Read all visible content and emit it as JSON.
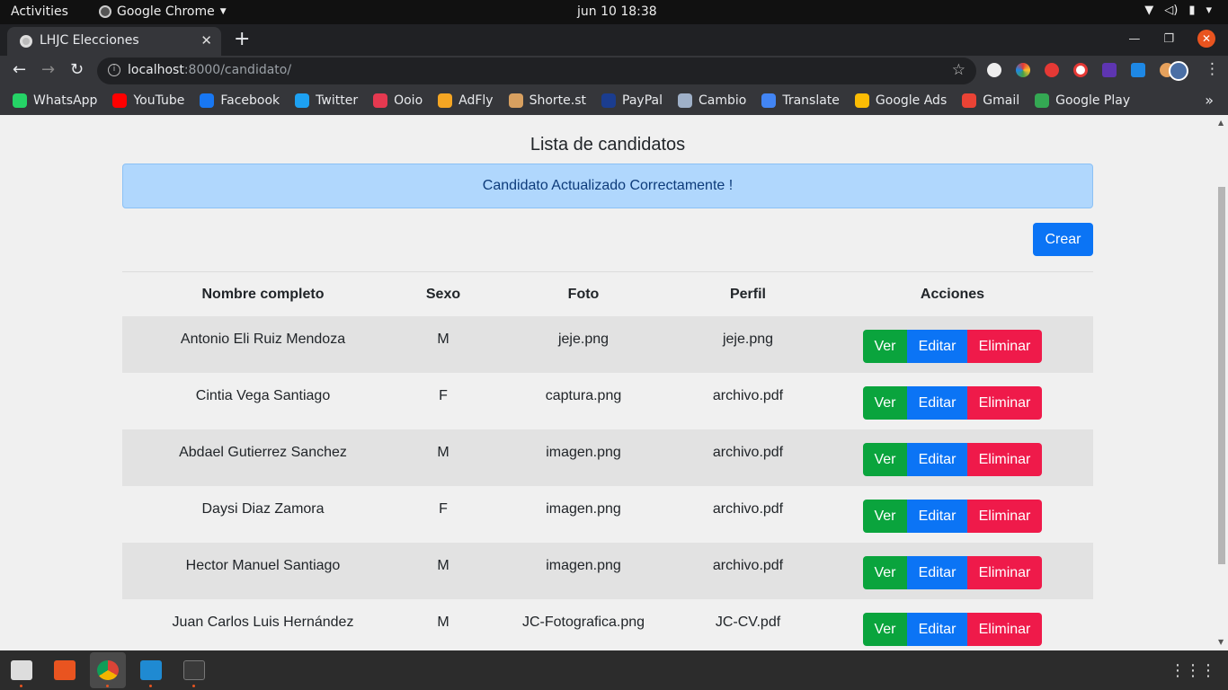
{
  "system_bar": {
    "activities": "Activities",
    "app_name": "Google Chrome",
    "clock": "jun 10  18:38"
  },
  "browser": {
    "tab_title": "LHJC Elecciones",
    "url_host": "localhost",
    "url_rest": ":8000/candidato/",
    "bookmarks": [
      {
        "label": "WhatsApp",
        "color": "#25d366"
      },
      {
        "label": "YouTube",
        "color": "#ff0000"
      },
      {
        "label": "Facebook",
        "color": "#1877f2"
      },
      {
        "label": "Twitter",
        "color": "#1da1f2"
      },
      {
        "label": "Ooio",
        "color": "#e53950"
      },
      {
        "label": "AdFly",
        "color": "#f5a623"
      },
      {
        "label": "Shorte.st",
        "color": "#d8a060"
      },
      {
        "label": "PayPal",
        "color": "#1b3d8f"
      },
      {
        "label": "Cambio",
        "color": "#9fb0c8"
      },
      {
        "label": "Translate",
        "color": "#4285f4"
      },
      {
        "label": "Google Ads",
        "color": "#fbbc04"
      },
      {
        "label": "Gmail",
        "color": "#ea4335"
      },
      {
        "label": "Google Play",
        "color": "#34a853"
      }
    ]
  },
  "page": {
    "title": "Lista de candidatos",
    "alert": "Candidato Actualizado Correctamente !",
    "create_label": "Crear",
    "columns": [
      "Nombre completo",
      "Sexo",
      "Foto",
      "Perfil",
      "Acciones"
    ],
    "action_labels": {
      "view": "Ver",
      "edit": "Editar",
      "delete": "Eliminar"
    },
    "rows": [
      {
        "name": "Antonio Eli Ruiz Mendoza",
        "sex": "M",
        "photo": "jeje.png",
        "profile": "jeje.png"
      },
      {
        "name": "Cintia Vega Santiago",
        "sex": "F",
        "photo": "captura.png",
        "profile": "archivo.pdf"
      },
      {
        "name": "Abdael Gutierrez Sanchez",
        "sex": "M",
        "photo": "imagen.png",
        "profile": "archivo.pdf"
      },
      {
        "name": "Daysi Diaz Zamora",
        "sex": "F",
        "photo": "imagen.png",
        "profile": "archivo.pdf"
      },
      {
        "name": "Hector Manuel Santiago",
        "sex": "M",
        "photo": "imagen.png",
        "profile": "archivo.pdf"
      },
      {
        "name": "Juan Carlos Luis Hernández",
        "sex": "M",
        "photo": "JC-Fotografica.png",
        "profile": "JC-CV.pdf"
      }
    ]
  },
  "colors": {
    "btn_view": "#0aa43d",
    "btn_edit": "#0b74f5",
    "btn_delete": "#ef1a4a",
    "alert_bg": "#b0d7fd"
  }
}
